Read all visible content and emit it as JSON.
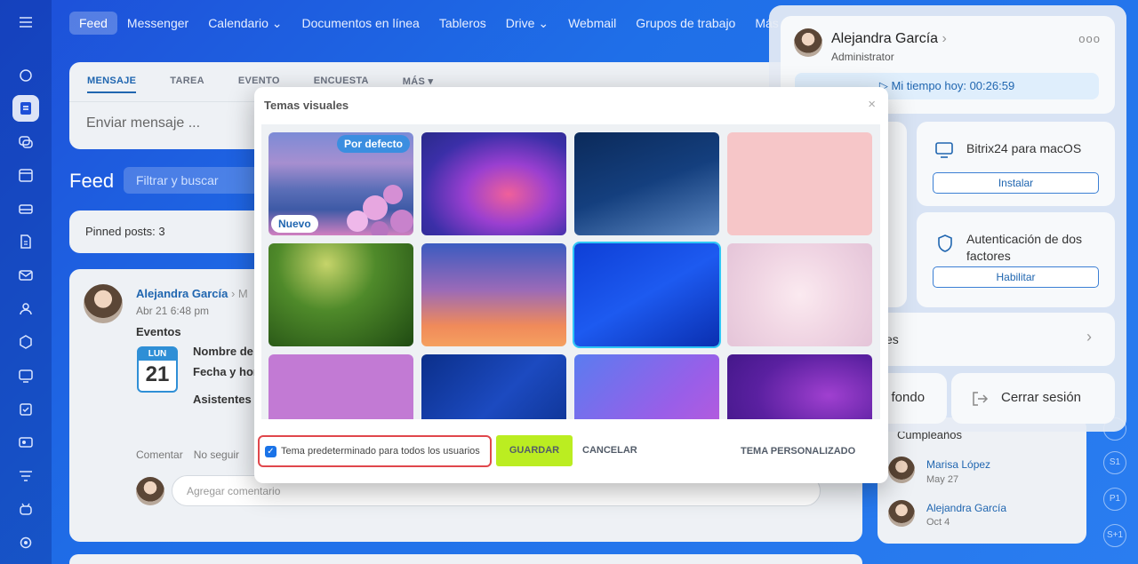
{
  "nav": {
    "items": [
      "Feed",
      "Messenger",
      "Calendario",
      "Documentos en línea",
      "Tableros",
      "Drive",
      "Webmail",
      "Grupos de trabajo",
      "Más"
    ],
    "dropdown_suffix": "⌄"
  },
  "composer": {
    "tabs": [
      "MENSAJE",
      "TAREA",
      "EVENTO",
      "ENCUESTA",
      "MÁS ▾"
    ],
    "placeholder": "Enviar mensaje ..."
  },
  "feed": {
    "title": "Feed",
    "filter_placeholder": "Filtrar y buscar",
    "pinned": "Pinned posts: 3"
  },
  "post": {
    "author": "Alejandra García",
    "author_suffix": "›  M",
    "date": "Abr 21 6:48 pm",
    "type": "Eventos",
    "cal_month": "LUN",
    "cal_day": "21",
    "field1": "Nombre de",
    "field2": "Fecha y hor",
    "field3": "Asistentes",
    "actions": [
      "Comentar",
      "No seguir"
    ],
    "comment_placeholder": "Agregar comentario"
  },
  "birthdays": {
    "title": "Cumpleaños",
    "people": [
      {
        "name": "Marisa López",
        "date": "May 27"
      },
      {
        "name": "Alejandra García",
        "date": "Oct 4"
      }
    ]
  },
  "badges": [
    "S1",
    "P1",
    "S+1"
  ],
  "user_panel": {
    "name": "Alejandra García",
    "name_chevron": "›",
    "role": "Administrator",
    "more": "ooo",
    "time": "Mi tiempo hoy: 00:26:59",
    "mac_title": "Bitrix24 para macOS",
    "mac_button": "Instalar",
    "twofa_title": "Autenticación de dos factores",
    "twofa_button": "Habilitar",
    "row_text": "es",
    "row_chevron": "›",
    "fondo": "l fondo",
    "logout": "Cerrar sesión"
  },
  "modal": {
    "title": "Temas visuales",
    "close": "×",
    "tag_default": "Por defecto",
    "tag_new": "Nuevo",
    "checkbox_label": "Tema predeterminado para todos los usuarios",
    "save": "GUARDAR",
    "cancel": "CANCELAR",
    "custom": "TEMA PERSONALIZADO"
  },
  "colors": {
    "accent": "#2066b0",
    "save_button": "#bbed21",
    "highlight_border": "#e0474c",
    "selected_outline": "#2fc6f6"
  }
}
